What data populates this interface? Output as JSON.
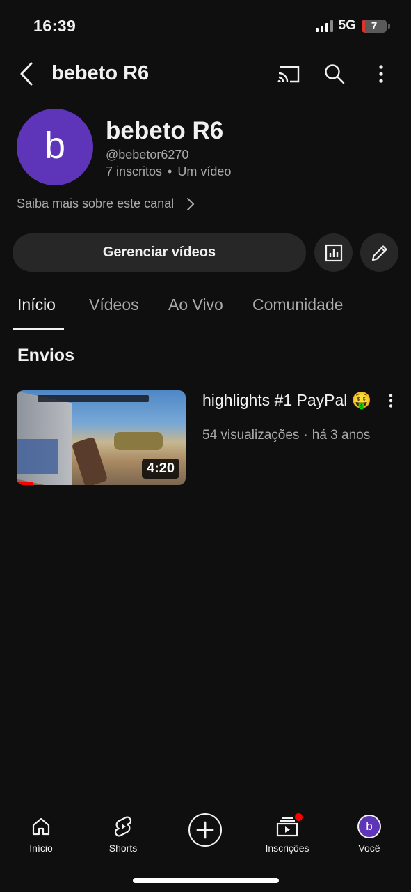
{
  "status_bar": {
    "time": "16:39",
    "network": "5G",
    "battery": "7"
  },
  "topbar": {
    "title": "bebeto R6"
  },
  "channel": {
    "avatar_letter": "b",
    "name": "bebeto R6",
    "handle": "@bebetor6270",
    "subscribers": "7 inscritos",
    "separator": "•",
    "videos": "Um vídeo",
    "more_about": "Saiba mais sobre este canal"
  },
  "actions": {
    "manage_label": "Gerenciar vídeos"
  },
  "tabs": [
    {
      "label": "Início"
    },
    {
      "label": "Vídeos"
    },
    {
      "label": "Ao Vivo"
    },
    {
      "label": "Comunidade"
    }
  ],
  "section": {
    "title": "Envios"
  },
  "videos": [
    {
      "title": "highlights #1 PayPal 🤑",
      "views": "54 visualizações",
      "separator": "·",
      "age": "há 3 anos",
      "duration": "4:20",
      "watched_fraction": 0.1
    }
  ],
  "bottom_nav": {
    "home": "Início",
    "shorts": "Shorts",
    "subscriptions": "Inscrições",
    "you": "Você",
    "you_avatar": "b"
  },
  "colors": {
    "background": "#0f0f0f",
    "avatar": "#5e34b8",
    "accent_red": "#ff0000",
    "button_bg": "#272727"
  }
}
